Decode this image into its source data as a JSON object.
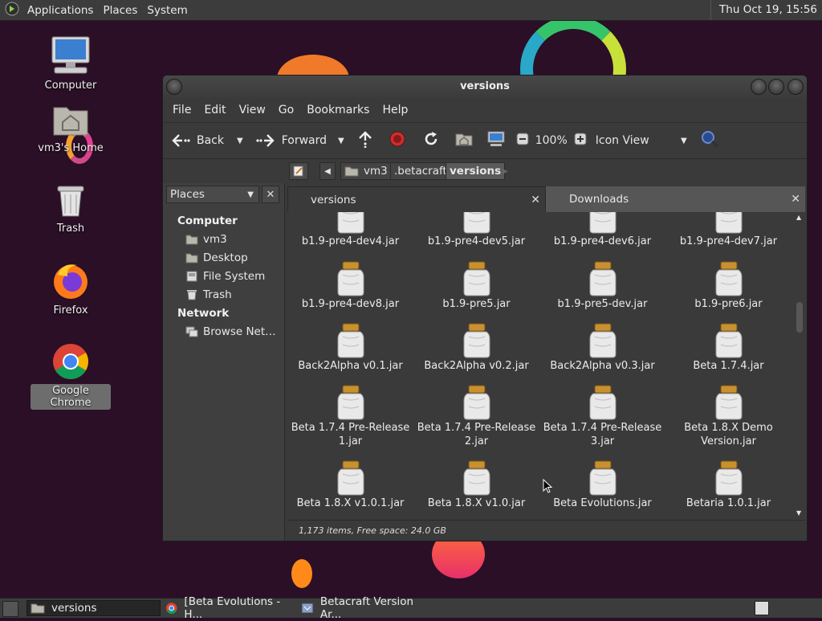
{
  "top_panel": {
    "menus": [
      "Applications",
      "Places",
      "System"
    ],
    "clock": "Thu Oct 19, 15:56"
  },
  "desktop_icons": [
    {
      "label": "Computer",
      "icon": "computer-icon"
    },
    {
      "label": "vm3's Home",
      "icon": "home-folder-icon"
    },
    {
      "label": "Trash",
      "icon": "trash-icon"
    },
    {
      "label": "Firefox",
      "icon": "firefox-icon"
    },
    {
      "label": "Google Chrome",
      "icon": "chrome-icon",
      "selected": true
    }
  ],
  "window": {
    "title": "versions",
    "menu": [
      "File",
      "Edit",
      "View",
      "Go",
      "Bookmarks",
      "Help"
    ],
    "toolbar": {
      "back": "Back",
      "forward": "Forward",
      "zoom": "100%",
      "view_mode": "Icon View"
    },
    "sidebar": {
      "places_label": "Places",
      "sections": [
        {
          "header": "Computer",
          "items": [
            {
              "label": "vm3",
              "icon": "home-folder-icon"
            },
            {
              "label": "Desktop",
              "icon": "desktop-folder-icon"
            },
            {
              "label": "File System",
              "icon": "drive-icon"
            },
            {
              "label": "Trash",
              "icon": "trash-icon"
            }
          ]
        },
        {
          "header": "Network",
          "items": [
            {
              "label": "Browse Net…",
              "icon": "network-icon"
            }
          ]
        }
      ]
    },
    "path": [
      "vm3",
      ".betacraft",
      "versions"
    ],
    "tabs": [
      {
        "label": "versions",
        "active": true
      },
      {
        "label": "Downloads",
        "active": false
      }
    ],
    "files": [
      "b1.9-pre4-dev4.jar",
      "b1.9-pre4-dev5.jar",
      "b1.9-pre4-dev6.jar",
      "b1.9-pre4-dev7.jar",
      "b1.9-pre4-dev8.jar",
      "b1.9-pre5.jar",
      "b1.9-pre5-dev.jar",
      "b1.9-pre6.jar",
      "Back2Alpha v0.1.jar",
      "Back2Alpha v0.2.jar",
      "Back2Alpha v0.3.jar",
      "Beta 1.7.4.jar",
      "Beta 1.7.4 Pre-Release 1.jar",
      "Beta 1.7.4 Pre-Release 2.jar",
      "Beta 1.7.4 Pre-Release 3.jar",
      "Beta 1.8.X Demo Version.jar",
      "Beta 1.8.X v1.0.1.jar",
      "Beta 1.8.X v1.0.jar",
      "Beta Evolutions.jar",
      "Betaria 1.0.1.jar"
    ],
    "status": "1,173 items, Free space: 24.0 GB"
  },
  "taskbar": {
    "tasks": [
      {
        "label": "versions",
        "icon": "folder-icon",
        "active": true
      },
      {
        "label": "[Beta Evolutions - H...",
        "icon": "chrome-icon",
        "active": false
      },
      {
        "label": "Betacraft Version Ar...",
        "icon": "java-app-icon",
        "active": false
      }
    ]
  },
  "colors": {
    "desktop_bg": "#2a0f26",
    "panel": "#3c3c3c",
    "window": "#3a3a3a"
  }
}
